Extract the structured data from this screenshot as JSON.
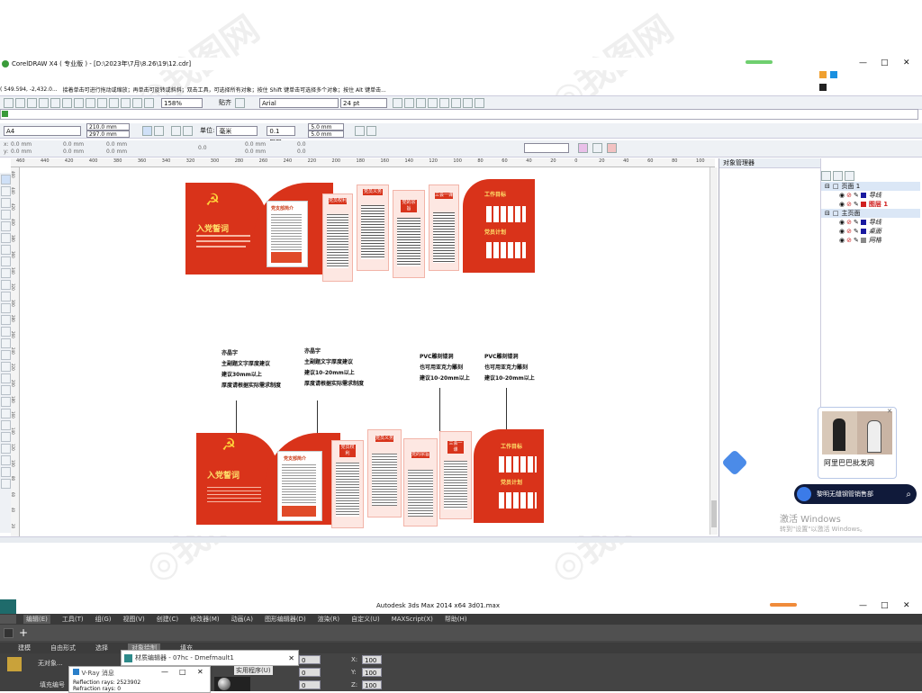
{
  "window": {
    "title": "CorelDRAW X4 ( 专业版 ) - [D:\\2023年\\7月\\8.26\\19\\12.cdr]",
    "app_icon": "coreldraw-logo",
    "controls": [
      "—",
      "□",
      "✕"
    ]
  },
  "status_line": {
    "coords": "( 549.594, -2,432.0... ",
    "hint": "接着单击可进行拖动或缩放；再单击可旋转或斜斜；双击工具，可选择所有对象；按住 Shift 键单击可选择多个对象；按住 Alt 键单击..."
  },
  "toolbar": {
    "zoom": "158%",
    "snap_label": "贴齐",
    "font": "Arial",
    "font_size": "24 pt"
  },
  "property_bar": {
    "paper": "A4",
    "width": "210.0 mm",
    "height": "297.0 mm",
    "unit_label": "单位:",
    "unit": "毫米",
    "nudge": "0.1 mm",
    "dup_x": "5.0 mm",
    "dup_y": "5.0 mm"
  },
  "object_bar": {
    "x": "0.0 mm",
    "y": "0.0 mm",
    "w": "0.0 mm",
    "h": "0.0 mm",
    "w2": "0.0 mm",
    "h2": "0.0 mm",
    "angle": "0.0",
    "v1": "0.0 mm",
    "v2": "0.0 mm",
    "v3": "0.0",
    "v4": "0.0"
  },
  "ruler": {
    "ticks": [
      "460",
      "440",
      "420",
      "400",
      "380",
      "360",
      "340",
      "320",
      "300",
      "280",
      "260",
      "240",
      "220",
      "200",
      "180",
      "160",
      "140",
      "120",
      "100",
      "80",
      "60",
      "40",
      "20",
      "0",
      "20",
      "40",
      "60",
      "80",
      "100"
    ],
    "hticks": [
      "460",
      "440",
      "420",
      "400",
      "380",
      "360",
      "340",
      "320",
      "300",
      "280",
      "260",
      "240",
      "220",
      "200",
      "180",
      "160",
      "140",
      "120",
      "100",
      "80",
      "60",
      "40",
      "20"
    ]
  },
  "object_manager": {
    "title": "对象管理器",
    "page1": "页面 1",
    "page1_layers": [
      {
        "name": "导线",
        "color": "#1a1aa0"
      },
      {
        "name": "图层 1",
        "color": "#d02020",
        "highlight": true
      }
    ],
    "master": "主页面",
    "master_layers": [
      {
        "name": "导线",
        "color": "#1a1aa0"
      },
      {
        "name": "桌面",
        "color": "#1a1aa0"
      },
      {
        "name": "网格",
        "color": "#888888"
      }
    ]
  },
  "ad": {
    "caption": "阿里巴巴批发网",
    "chat": "黎明无缝钢管销售部",
    "close": "✕"
  },
  "activate": {
    "line1": "激活 Windows",
    "line2": "转到\"设置\"以激活 Windows。"
  },
  "design": {
    "panel_intro_title": "入党誓词",
    "panel_branch_title": "党支部简介",
    "tags": [
      "党员权利",
      "党员义务",
      "党的宗旨",
      "三会一课"
    ],
    "work_plan": "工作目标",
    "party_plan": "党员计划",
    "notes": [
      [
        "亦晶字",
        "主副题文字厚度建议",
        "建议30mm以上",
        "厚度请根据实际需求制度"
      ],
      [
        "亦晶字",
        "主副题文字厚度建议",
        "建议10-20mm以上",
        "厚度请根据实际需求制度"
      ],
      [
        "PVC雕刻镂洞",
        "也可用亚克力雕刻",
        "建议10-20mm以上"
      ],
      [
        "PVC雕刻镂洞",
        "也可用亚克力雕刻",
        "建议10-20mm以上"
      ]
    ]
  },
  "max_window": {
    "title": "Autodesk 3ds Max  2014 x64     3d01.max",
    "menus": [
      "编辑(E)",
      "工具(T)",
      "组(G)",
      "视图(V)",
      "创建(C)",
      "修改器(M)",
      "动画(A)",
      "图形编辑器(D)",
      "渲染(R)",
      "自定义(U)",
      "MAXScript(X)",
      "帮助(H)"
    ],
    "subtabs": [
      "建模",
      "自由形式",
      "选择",
      "对象绘制",
      "填充"
    ],
    "material_editor": "材质编辑器 - 07hc - Dmefmault1",
    "utilities": "实用程序(U)",
    "no_object": "无对象...",
    "fill_label": "填充编号",
    "vray_title": "V-Ray 消息",
    "vray_line1": "Reflection rays: 2523902",
    "vray_line2": "Refraction rays: 0",
    "x_label": "X:",
    "y_label": "Y:",
    "z_label": "Z:",
    "x_val": "100",
    "y_val": "100",
    "z_val": "100",
    "spin0": "0"
  }
}
